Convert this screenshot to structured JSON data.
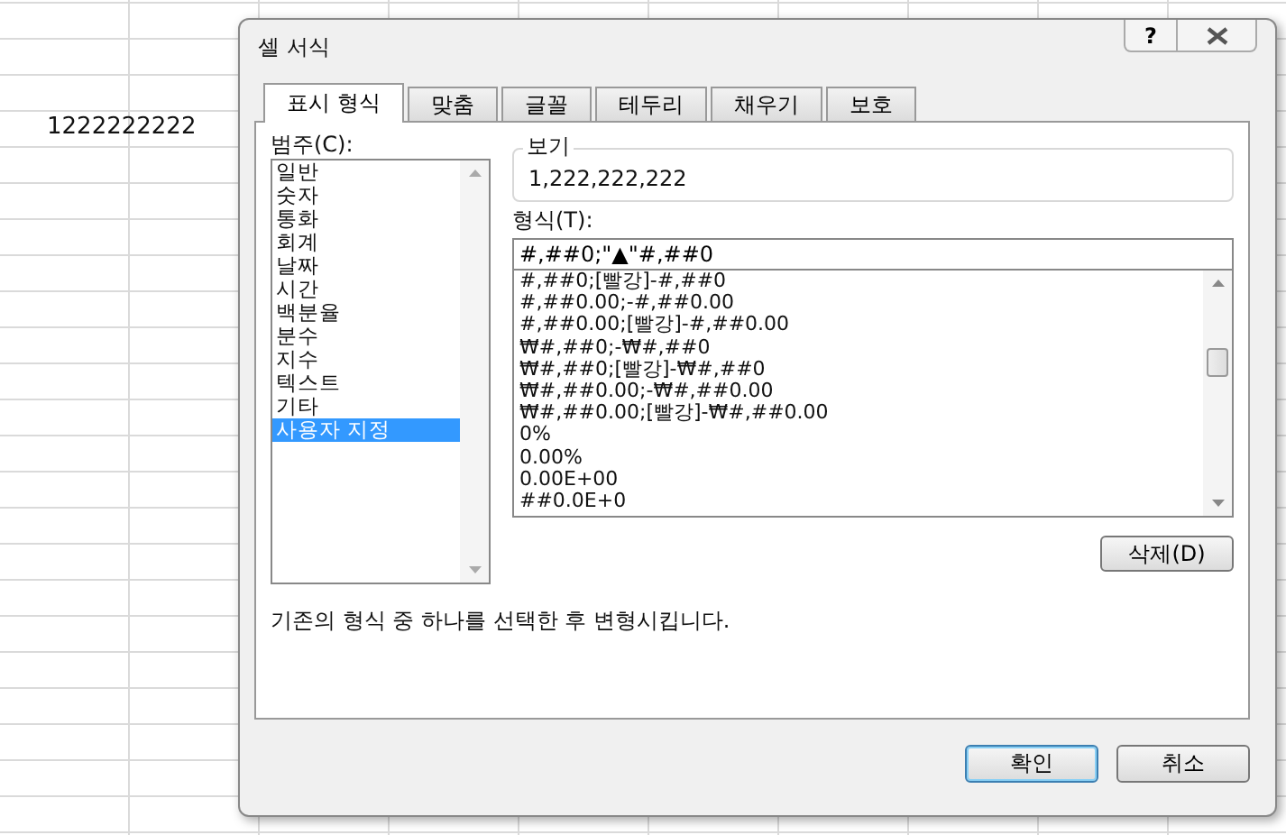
{
  "sheet": {
    "cell_value": "1222222222"
  },
  "window": {
    "title": "셀 서식",
    "help": "?"
  },
  "tabs": [
    {
      "label": "표시 형식",
      "selected": true
    },
    {
      "label": "맞춤",
      "selected": false
    },
    {
      "label": "글꼴",
      "selected": false
    },
    {
      "label": "테두리",
      "selected": false
    },
    {
      "label": "채우기",
      "selected": false
    },
    {
      "label": "보호",
      "selected": false
    }
  ],
  "category": {
    "label": "범주(C):",
    "items": [
      {
        "label": "일반",
        "selected": false
      },
      {
        "label": "숫자",
        "selected": false
      },
      {
        "label": "통화",
        "selected": false
      },
      {
        "label": "회계",
        "selected": false
      },
      {
        "label": "날짜",
        "selected": false
      },
      {
        "label": "시간",
        "selected": false
      },
      {
        "label": "백분율",
        "selected": false
      },
      {
        "label": "분수",
        "selected": false
      },
      {
        "label": "지수",
        "selected": false
      },
      {
        "label": "텍스트",
        "selected": false
      },
      {
        "label": "기타",
        "selected": false
      },
      {
        "label": "사용자 지정",
        "selected": true
      }
    ]
  },
  "preview": {
    "label": "보기",
    "value": "1,222,222,222"
  },
  "format": {
    "label": "형식(T):",
    "value": "#,##0;\"▲\"#,##0",
    "items": [
      "#,##0;[빨강]-#,##0",
      "#,##0.00;-#,##0.00",
      "#,##0.00;[빨강]-#,##0.00",
      "₩#,##0;-₩#,##0",
      "₩#,##0;[빨강]-₩#,##0",
      "₩#,##0.00;-₩#,##0.00",
      "₩#,##0.00;[빨강]-₩#,##0.00",
      "0%",
      "0.00%",
      "0.00E+00",
      "##0.0E+0"
    ]
  },
  "delete_button": "삭제(D)",
  "description": "기존의 형식 중 하나를 선택한 후 변형시킵니다.",
  "buttons": [
    {
      "label": "확인",
      "kind": "default"
    },
    {
      "label": "취소",
      "kind": "normal"
    }
  ]
}
